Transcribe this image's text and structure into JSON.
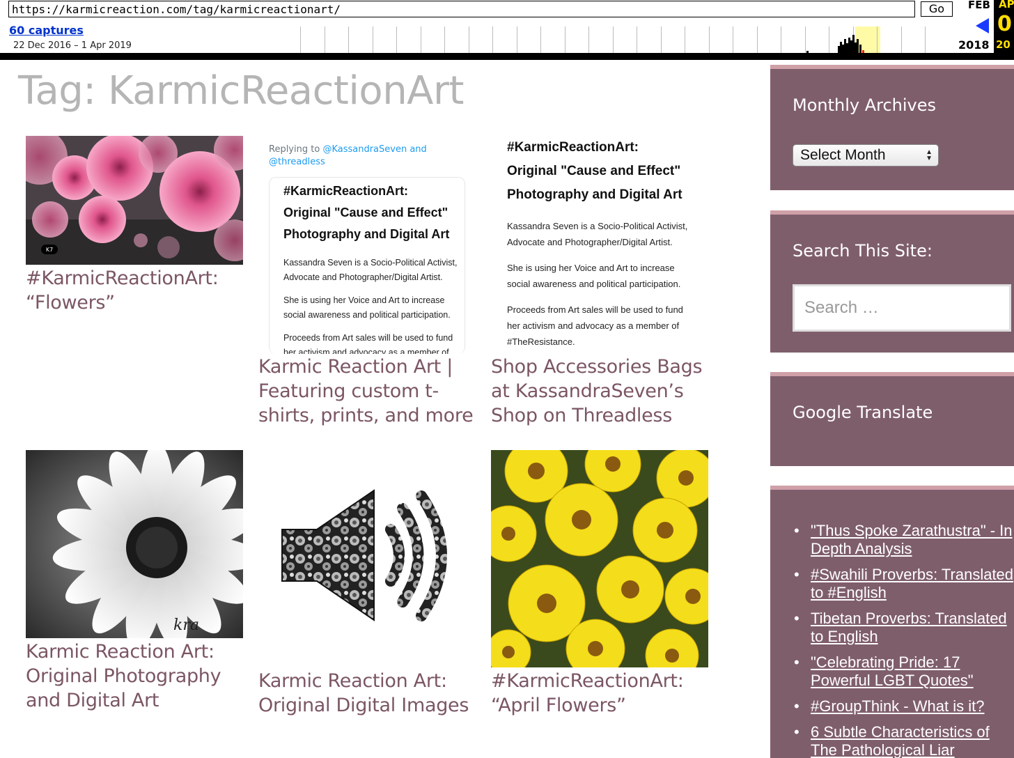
{
  "wayback": {
    "url": "https://karmicreaction.com/tag/karmicreactionart/",
    "go_label": "Go",
    "captures_label": "60 captures",
    "date_range": "22 Dec 2016 – 1 Apr 2019",
    "prev_month": "FEB",
    "prev_year": "2018",
    "current_month": "AP",
    "current_day": "0",
    "current_year": "20"
  },
  "page": {
    "title": "Tag: KarmicReactionArt"
  },
  "posts": [
    {
      "title": "#KarmicReactionArt: “Flowers”",
      "image": "pink-dahlias-photo"
    },
    {
      "title": "Karmic Reaction Art | Featuring custom t-shirts, prints, and more",
      "image": "tweet-card-screenshot"
    },
    {
      "title": "Shop Accessories Bags at KassandraSeven’s Shop on Threadless",
      "image": "text-card-image"
    },
    {
      "title": "Karmic Reaction Art: Original Photography and Digital Art",
      "image": "black-white-daisy-photo"
    },
    {
      "title": "Karmic Reaction Art: Original Digital Images",
      "image": "speaker-icon-floral"
    },
    {
      "title": "#KarmicReactionArt: “April Flowers”",
      "image": "yellow-flowers-photo"
    }
  ],
  "tweet_card": {
    "reply_prefix": "Replying to ",
    "reply_handles": "@KassandraSeven and @threadless",
    "heading_line1": "#KarmicReactionArt:",
    "heading_line2": "Original \"Cause and Effect\"",
    "heading_line3": "Photography and Digital Art",
    "body_line1": "Kassandra Seven is a Socio-Political Activist,",
    "body_line2": "Advocate and Photographer/Digital Artist.",
    "body_line3": "She is using her Voice and Art to increase",
    "body_line4": "social awareness and political participation.",
    "body_line5": "Proceeds from Art sales will be used to fund",
    "body_line6": "her activism and advocacy as a member of"
  },
  "text_card": {
    "heading_line1": "#KarmicReactionArt:",
    "heading_line2": "Original \"Cause and Effect\"",
    "heading_line3": "Photography and Digital Art",
    "body_line1": "Kassandra Seven is a Socio-Political Activist,",
    "body_line2": "Advocate and Photographer/Digital Artist.",
    "body_line3": "She is using her Voice and Art to increase",
    "body_line4": "social awareness and political participation.",
    "body_line5": "Proceeds from Art sales will be used to fund",
    "body_line6": "her activism and advocacy as a member of",
    "body_line7": "#TheResistance."
  },
  "photo_marks": {
    "pink_badge": "K7",
    "daisy_signature": "kra"
  },
  "sidebar": {
    "archives_title": "Monthly Archives",
    "archives_select": "Select Month",
    "search_title": "Search This Site:",
    "search_placeholder": "Search …",
    "translate_title": "Google Translate",
    "links": [
      "\"Thus Spoke Zarathustra\" - In Depth Analysis",
      "#Swahili Proverbs: Translated to #English",
      "Tibetan Proverbs: Translated to English",
      "\"Celebrating Pride: 17 Powerful LGBT Quotes\"",
      "#GroupThink - What is it?",
      "6 Subtle Characteristics of The Pathological Liar"
    ]
  },
  "colors": {
    "accent": "#7b5664",
    "sidebar_bg": "#7f5e6c",
    "sidebar_border": "#cfa0a8",
    "title_gray": "#b5b5b5"
  }
}
